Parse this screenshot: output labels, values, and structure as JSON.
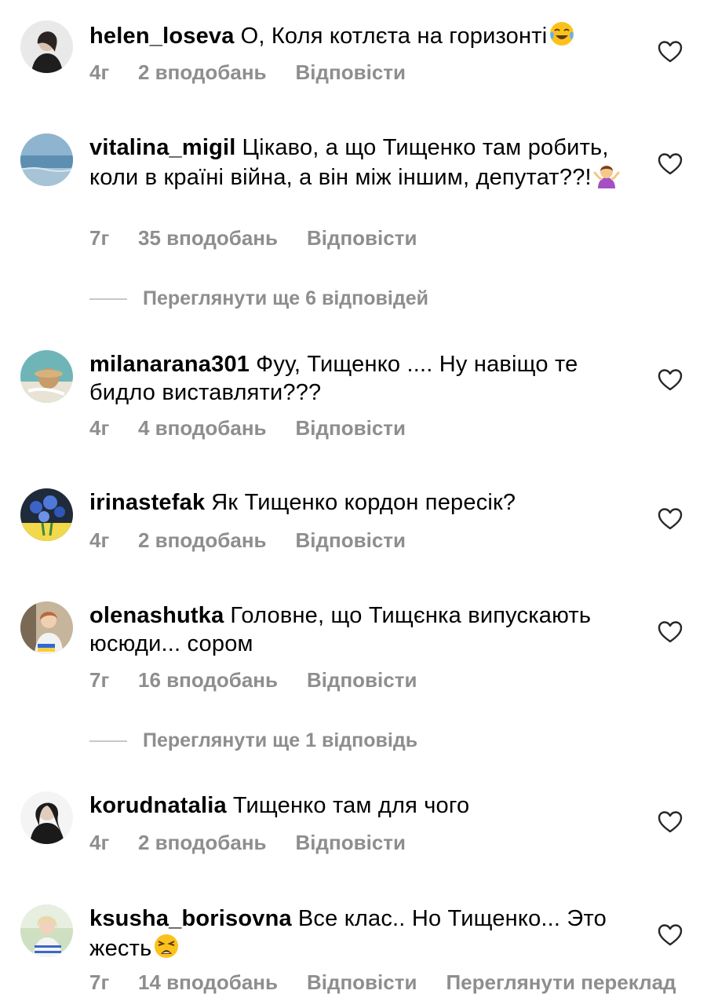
{
  "colors": {
    "text": "#000000",
    "meta": "#8e8e8e",
    "divider": "#c7c7c7"
  },
  "comments": [
    {
      "username": "helen_loseva",
      "text": "О, Коля котлєта на горизонті",
      "emoji": "tears-of-joy-emoji",
      "time": "4г",
      "likes": "2 вподобань",
      "reply": "Відповісти"
    },
    {
      "username": "vitalina_migil",
      "text": "Цікаво, а що Тищенко там робить, коли в країні війна, а він між іншим, депутат??!",
      "emoji": "shrug-emoji",
      "time": "7г",
      "likes": "35 вподобань",
      "reply": "Відповісти"
    },
    {
      "username": "milanarana301",
      "text": "Фуу, Тищенко .... Ну навіщо те бидло виставляти???",
      "time": "4г",
      "likes": "4 вподобань",
      "reply": "Відповісти"
    },
    {
      "username": "irinastefak",
      "text": "Як Тищенко кордон пересік?",
      "time": "4г",
      "likes": "2 вподобань",
      "reply": "Відповісти"
    },
    {
      "username": "olenashutka",
      "text": "Головне, що Тищєнка випускають юсюди... сором",
      "time": "7г",
      "likes": "16 вподобань",
      "reply": "Відповісти"
    },
    {
      "username": "korudnatalia",
      "text": "Тищенко там для чого",
      "time": "4г",
      "likes": "2 вподобань",
      "reply": "Відповісти"
    },
    {
      "username": "ksusha_borisovna",
      "text": "Все клас.. Но Тищенко... Это жесть",
      "emoji": "weary-emoji",
      "time": "7г",
      "likes": "14 вподобань",
      "reply": "Відповісти",
      "translate": "Переглянути переклад"
    }
  ],
  "view_replies": [
    "Переглянути ще 6 відповідей",
    "Переглянути ще 1 відповідь"
  ]
}
